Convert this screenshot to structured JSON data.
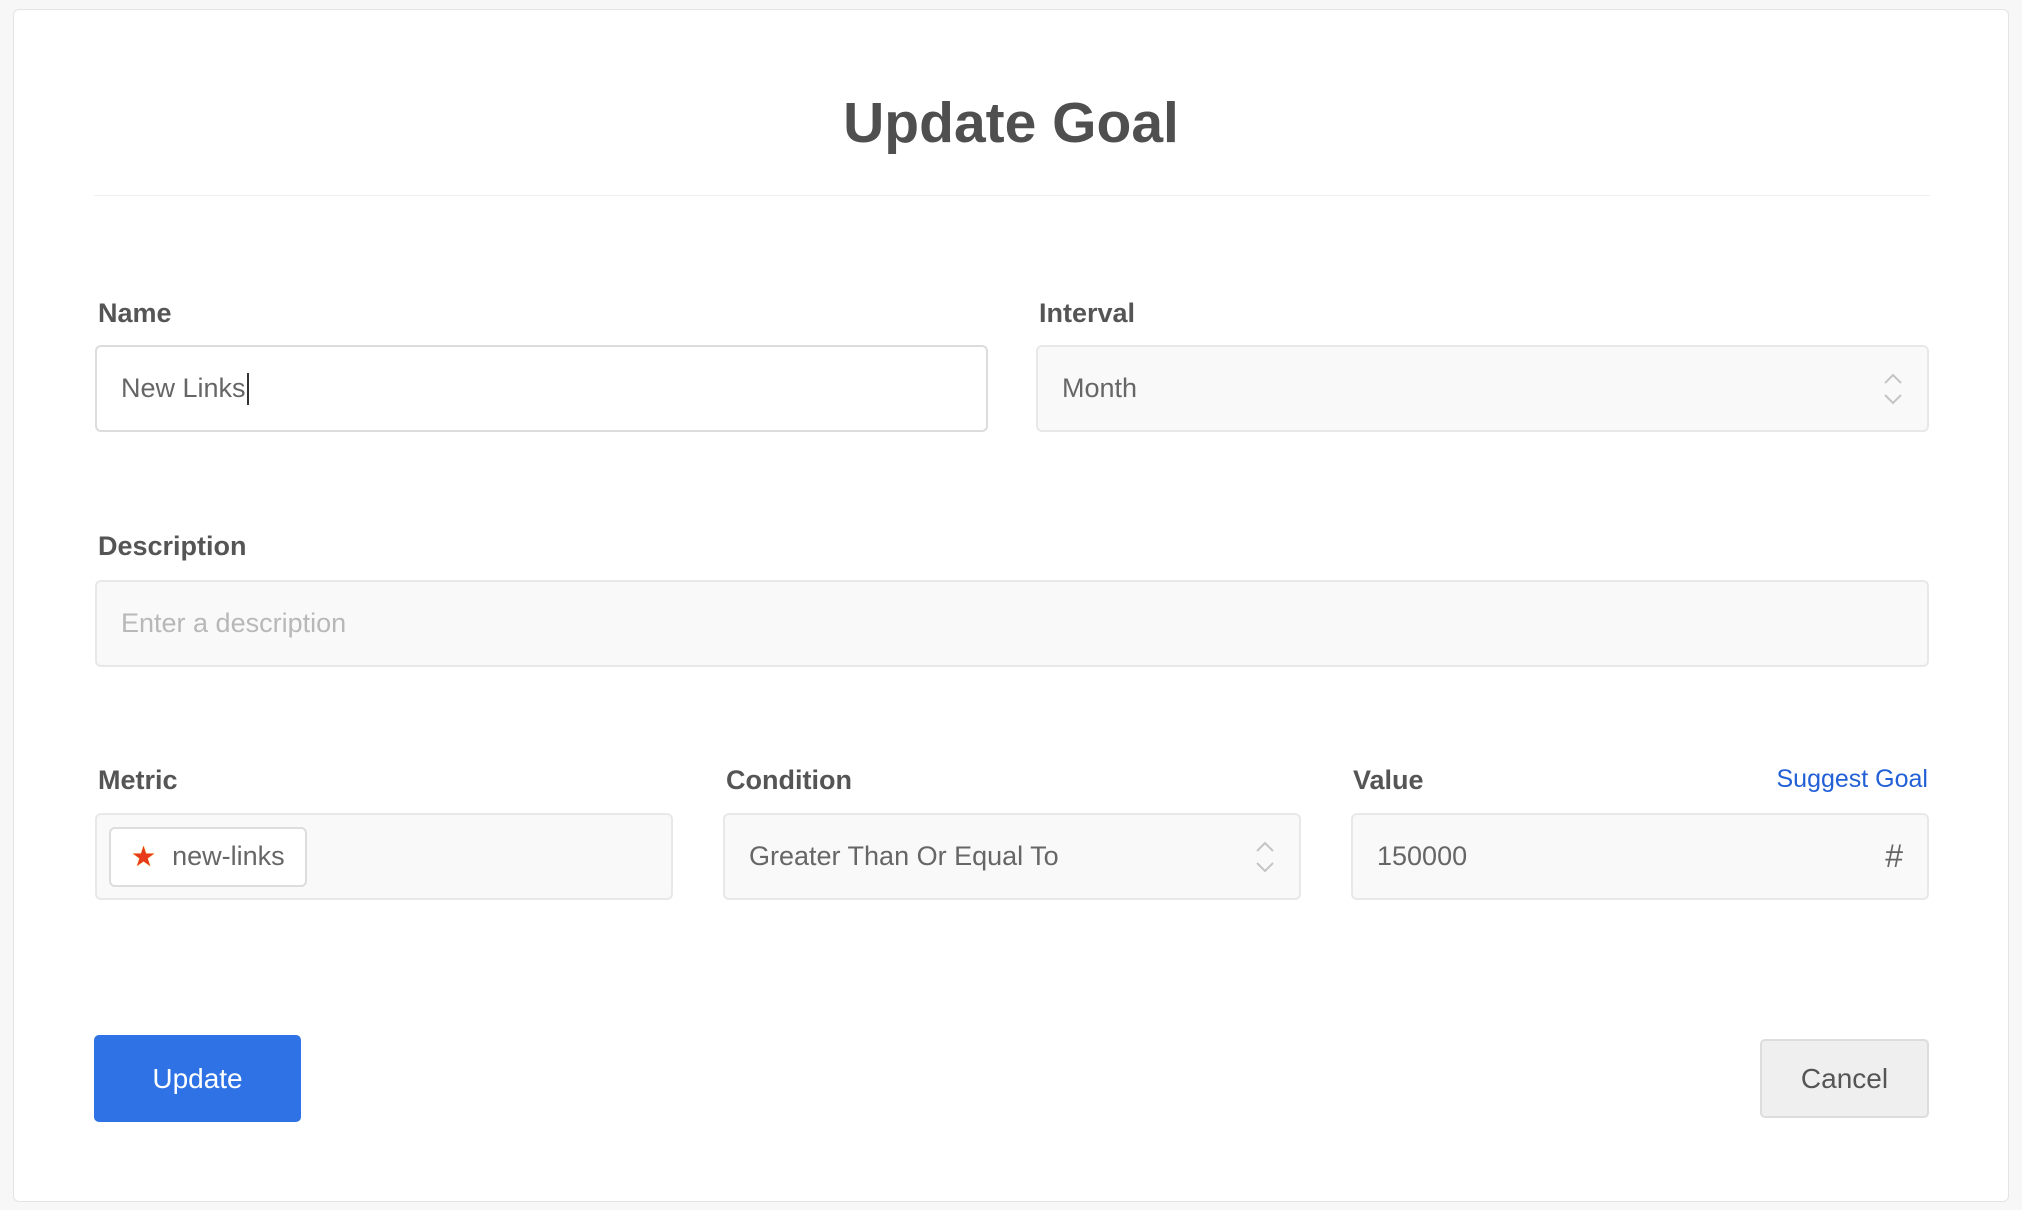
{
  "dialog": {
    "title": "Update Goal"
  },
  "form": {
    "name": {
      "label": "Name",
      "value": "New Links"
    },
    "interval": {
      "label": "Interval",
      "value": "Month"
    },
    "description": {
      "label": "Description",
      "placeholder": "Enter a description",
      "value": ""
    },
    "metric": {
      "label": "Metric",
      "chip": "new-links",
      "chip_icon": "star-icon"
    },
    "condition": {
      "label": "Condition",
      "value": "Greater Than Or Equal To"
    },
    "value": {
      "label": "Value",
      "value": "150000",
      "suffix": "#",
      "suggest_link": "Suggest Goal"
    }
  },
  "actions": {
    "update_label": "Update",
    "cancel_label": "Cancel"
  },
  "colors": {
    "primary": "#2f72e6",
    "link": "#2260d6",
    "star": "#e8391d"
  }
}
